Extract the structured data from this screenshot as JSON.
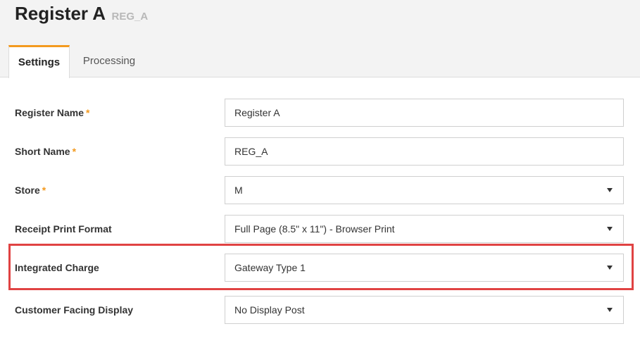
{
  "header": {
    "title": "Register A",
    "subtitle": "REG_A"
  },
  "tabs": [
    {
      "label": "Settings",
      "active": true
    },
    {
      "label": "Processing",
      "active": false
    }
  ],
  "colors": {
    "accent": "#f39a1f",
    "highlight": "#e04343"
  },
  "form": {
    "required_mark": "*",
    "register_name": {
      "label": "Register Name",
      "value": "Register A",
      "required": true
    },
    "short_name": {
      "label": "Short Name",
      "value": "REG_A",
      "required": true
    },
    "store": {
      "label": "Store",
      "value": "M",
      "required": true,
      "icon": "chevron-down-icon"
    },
    "receipt_print_format": {
      "label": "Receipt Print Format",
      "value": "Full Page (8.5\" x 11\") - Browser Print",
      "icon": "chevron-down-icon"
    },
    "integrated_charge": {
      "label": "Integrated Charge",
      "value": "Gateway Type 1",
      "icon": "chevron-down-icon",
      "highlighted": true
    },
    "customer_facing_display": {
      "label": "Customer Facing Display",
      "value": "No Display Post",
      "icon": "chevron-down-icon"
    }
  }
}
